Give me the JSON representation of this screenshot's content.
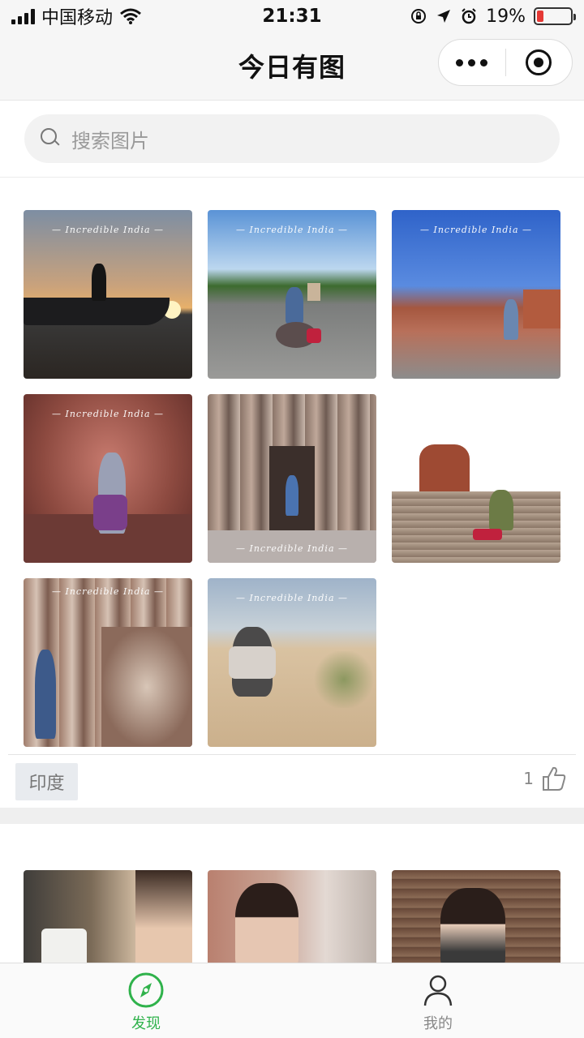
{
  "status_bar": {
    "carrier": "中国移动",
    "time": "21:31",
    "battery": "19%",
    "battery_level": 0.19
  },
  "header": {
    "title": "今日有图"
  },
  "search": {
    "placeholder": "搜索图片"
  },
  "posts": [
    {
      "watermark": "— Incredible India —",
      "tag": "印度",
      "likes": "1",
      "image_count": 8
    },
    {
      "image_count": 3
    }
  ],
  "tab_bar": {
    "tabs": [
      {
        "label": "发现",
        "icon": "compass-icon",
        "active": true
      },
      {
        "label": "我的",
        "icon": "user-icon",
        "active": false
      }
    ]
  },
  "colors": {
    "accent": "#2fb24b",
    "tag_bg": "#e8ebef",
    "battery_low": "#e53935"
  }
}
